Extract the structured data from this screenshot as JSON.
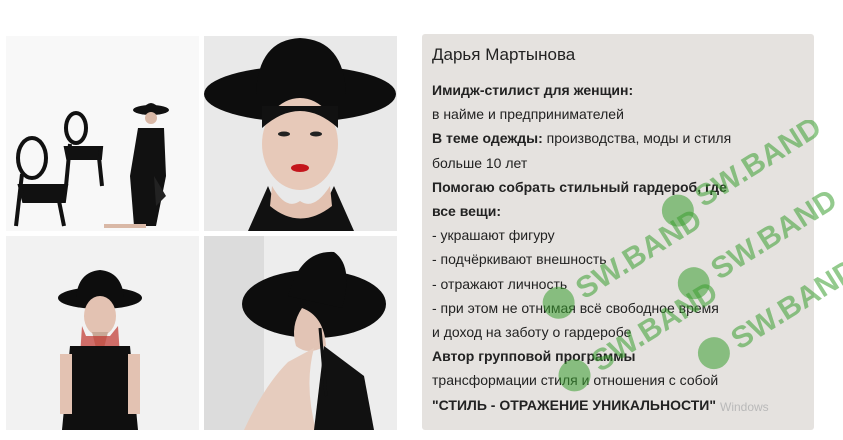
{
  "profile": {
    "name": "Дарья Мартынова",
    "lines": [
      {
        "bold": "Имидж-стилист для женщин:",
        "text": ""
      },
      {
        "bold": "",
        "text": "в найме и предпринимателей"
      },
      {
        "bold": "В теме одежды:",
        "text": " производства, моды и стиля"
      },
      {
        "bold": "",
        "text": "больше 10 лет"
      },
      {
        "bold": "Помогаю собрать стильный гардероб, где",
        "text": ""
      },
      {
        "bold": "все вещи:",
        "text": ""
      },
      {
        "bold": "",
        "text": "- украшают фигуру"
      },
      {
        "bold": "",
        "text": "- подчёркивают внешность"
      },
      {
        "bold": "",
        "text": "- отражают личность"
      },
      {
        "bold": "",
        "text": "- при этом не отнимая всё свободное время"
      },
      {
        "bold": "",
        "text": "и доход на заботу о гардеробе"
      },
      {
        "bold": "Автор групповой программы",
        "text": ""
      },
      {
        "bold": "",
        "text": "трансформации стиля и отношения с собой"
      },
      {
        "bold": "\"СТИЛЬ - ОТРАЖЕНИЕ УНИКАЛЬНОСТИ\"",
        "text": ""
      }
    ]
  },
  "watermark": {
    "text": "SW.BAND",
    "color": "#3a9e2f"
  },
  "os_overlay": {
    "text": "Windows"
  },
  "colors": {
    "card_bg": "#e5e2df",
    "text": "#222222"
  }
}
